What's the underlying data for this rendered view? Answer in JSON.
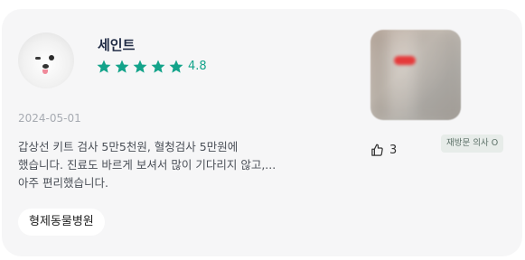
{
  "review": {
    "user_name": "세인트",
    "stars": 5,
    "rating": "4.8",
    "date": "2024-05-01",
    "text_lines": [
      "갑상선 키트 검사 5만5천원, 혈청검사 5만원에",
      "했습니다. 진료도 바르게 보셔서 많이 기다리지 않고,...",
      "아주 편리했습니다."
    ],
    "hospital_tag": "형제동물병원",
    "like_count": "3",
    "badge_label": "재방문 의사 O"
  },
  "colors": {
    "accent": "#13a38a",
    "card_bg": "#f6f6f7"
  },
  "icons": [
    "avatar",
    "star-icon",
    "thumbs-up-icon",
    "check-circle-icon"
  ]
}
